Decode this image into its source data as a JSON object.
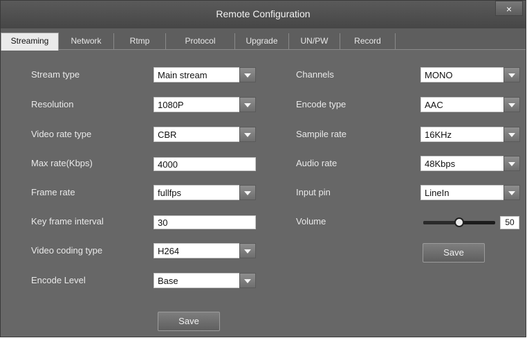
{
  "window": {
    "title": "Remote Configuration",
    "close_label": "×"
  },
  "tabs": [
    "Streaming",
    "Network",
    "Rtmp",
    "Protocol",
    "Upgrade",
    "UN/PW",
    "Record"
  ],
  "active_tab": "Streaming",
  "left": {
    "stream_type": {
      "label": "Stream type",
      "value": "Main stream"
    },
    "resolution": {
      "label": "Resolution",
      "value": "1080P"
    },
    "video_rate_type": {
      "label": "Video rate type",
      "value": "CBR"
    },
    "max_rate": {
      "label": "Max rate(Kbps)",
      "value": "4000"
    },
    "frame_rate": {
      "label": "Frame rate",
      "value": "fullfps"
    },
    "key_frame_interval": {
      "label": "Key frame interval",
      "value": "30"
    },
    "video_coding_type": {
      "label": "Video coding type",
      "value": "H264"
    },
    "encode_level": {
      "label": "Encode Level",
      "value": "Base"
    },
    "save_label": "Save"
  },
  "right": {
    "channels": {
      "label": "Channels",
      "value": "MONO"
    },
    "encode_type": {
      "label": "Encode type",
      "value": "AAC"
    },
    "sample_rate": {
      "label": "Sampile rate",
      "value": "16KHz"
    },
    "audio_rate": {
      "label": "Audio rate",
      "value": "48Kbps"
    },
    "input_pin": {
      "label": "Input pin",
      "value": "LineIn"
    },
    "volume": {
      "label": "Volume",
      "value": "50",
      "level_percent": 50
    },
    "save_label": "Save"
  },
  "colors": {
    "panel_bg": "#676767",
    "title_bg": "#4e4e4e",
    "active_tab_bg": "#eaeaea"
  }
}
